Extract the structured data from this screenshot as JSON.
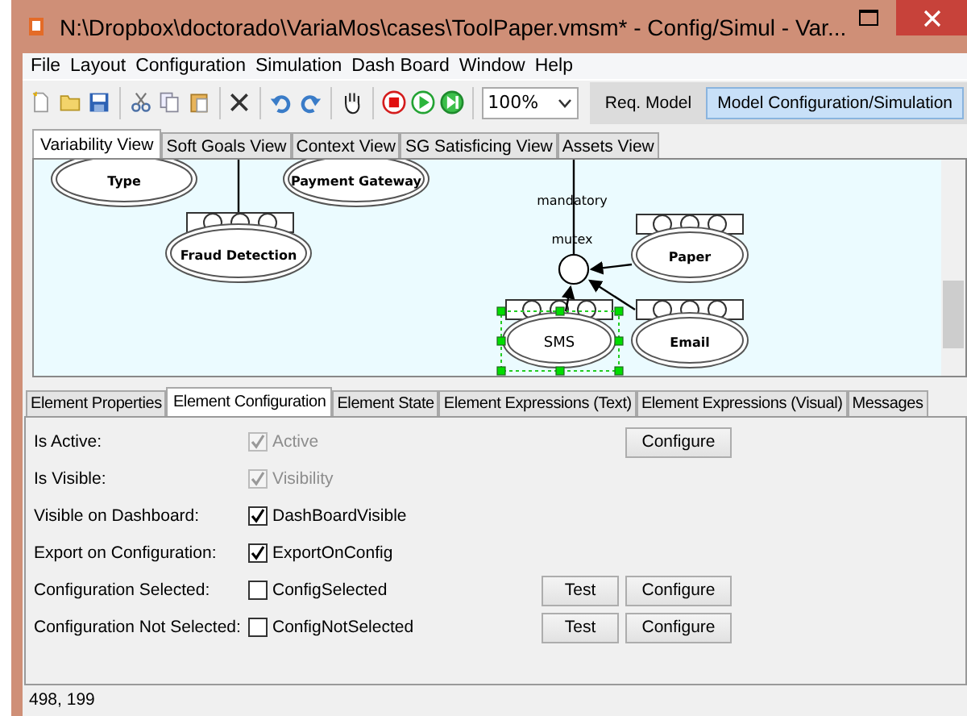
{
  "window": {
    "title": "N:\\Dropbox\\doctorado\\VariaMos\\cases\\ToolPaper.vmsm* - Config/Simul - Var..."
  },
  "menu": [
    "File",
    "Layout",
    "Configuration",
    "Simulation",
    "Dash Board",
    "Window",
    "Help"
  ],
  "toolbar": {
    "zoom": "100%",
    "modes": [
      {
        "label": "Req. Model",
        "selected": false
      },
      {
        "label": "Model Configuration/Simulation",
        "selected": true
      }
    ]
  },
  "view_tabs": [
    {
      "label": "Variability View",
      "selected": true
    },
    {
      "label": "Soft Goals View",
      "selected": false
    },
    {
      "label": "Context View",
      "selected": false
    },
    {
      "label": "SG Satisficing View",
      "selected": false
    },
    {
      "label": "Assets View",
      "selected": false
    }
  ],
  "diagram": {
    "labels": [
      "mandatory",
      "mutex"
    ],
    "nodes": [
      {
        "name": "Type",
        "selected": false
      },
      {
        "name": "Payment Gateway",
        "selected": false
      },
      {
        "name": "Fraud Detection",
        "selected": false
      },
      {
        "name": "Paper",
        "selected": false
      },
      {
        "name": "SMS",
        "selected": true
      },
      {
        "name": "Email",
        "selected": false
      }
    ]
  },
  "panel_tabs": [
    {
      "label": "Element Properties",
      "selected": false
    },
    {
      "label": "Element Configuration",
      "selected": true
    },
    {
      "label": "Element State",
      "selected": false
    },
    {
      "label": "Element Expressions (Text)",
      "selected": false
    },
    {
      "label": "Element Expressions (Visual)",
      "selected": false
    },
    {
      "label": "Messages",
      "selected": false
    }
  ],
  "config_rows": [
    {
      "label": "Is Active:",
      "option": "Active",
      "checked": true,
      "disabled": true,
      "buttons": [
        {
          "label": "Configure",
          "kind": "configure"
        }
      ]
    },
    {
      "label": "Is Visible:",
      "option": "Visibility",
      "checked": true,
      "disabled": true,
      "buttons": []
    },
    {
      "label": "Visible on Dashboard:",
      "option": "DashBoardVisible",
      "checked": true,
      "disabled": false,
      "buttons": []
    },
    {
      "label": "Export on Configuration:",
      "option": "ExportOnConfig",
      "checked": true,
      "disabled": false,
      "buttons": []
    },
    {
      "label": "Configuration Selected:",
      "option": "ConfigSelected",
      "checked": false,
      "disabled": false,
      "buttons": [
        {
          "label": "Test",
          "kind": "test"
        },
        {
          "label": "Configure",
          "kind": "configure"
        }
      ]
    },
    {
      "label": "Configuration Not Selected:",
      "option": "ConfigNotSelected",
      "checked": false,
      "disabled": false,
      "buttons": [
        {
          "label": "Test",
          "kind": "test"
        },
        {
          "label": "Configure",
          "kind": "configure"
        }
      ]
    }
  ],
  "status_bar": "498, 199"
}
